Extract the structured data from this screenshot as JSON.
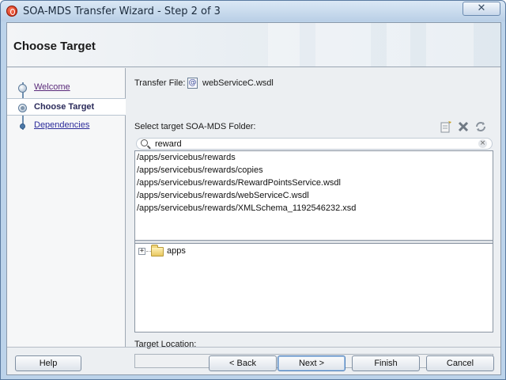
{
  "window": {
    "title": "SOA-MDS Transfer Wizard - Step 2 of 3",
    "close_glyph": "✕"
  },
  "header": {
    "title": "Choose Target"
  },
  "sidebar": {
    "items": [
      {
        "label": "Welcome",
        "state": "visited"
      },
      {
        "label": "Choose Target",
        "state": "active"
      },
      {
        "label": "Dependencies",
        "state": "link"
      }
    ]
  },
  "main": {
    "transfer_file_label": "Transfer File:",
    "transfer_file_icon": "@",
    "transfer_file_name": "webServiceC.wsdl",
    "folder_label": "Select target SOA-MDS Folder:",
    "toolbar_icons": [
      "new-folder-icon",
      "delete-icon",
      "refresh-icon"
    ],
    "search": {
      "value": "reward",
      "clear_glyph": "×"
    },
    "results": [
      "/apps/servicebus/rewards",
      "/apps/servicebus/rewards/copies",
      "/apps/servicebus/rewards/RewardPointsService.wsdl",
      "/apps/servicebus/rewards/webServiceC.wsdl",
      "/apps/servicebus/rewards/XMLSchema_1192546232.xsd"
    ],
    "tree": {
      "expander_glyph": "+",
      "root": "apps"
    },
    "target_location_label": "Target Location:",
    "target_location_value": ""
  },
  "footer": {
    "help": "Help",
    "back": "< Back",
    "next": "Next >",
    "finish": "Finish",
    "cancel": "Cancel"
  },
  "colors": {
    "title_bar": "#c7d9ec",
    "link": "#2b2b9a",
    "active_nav": "#2a2a5a"
  }
}
